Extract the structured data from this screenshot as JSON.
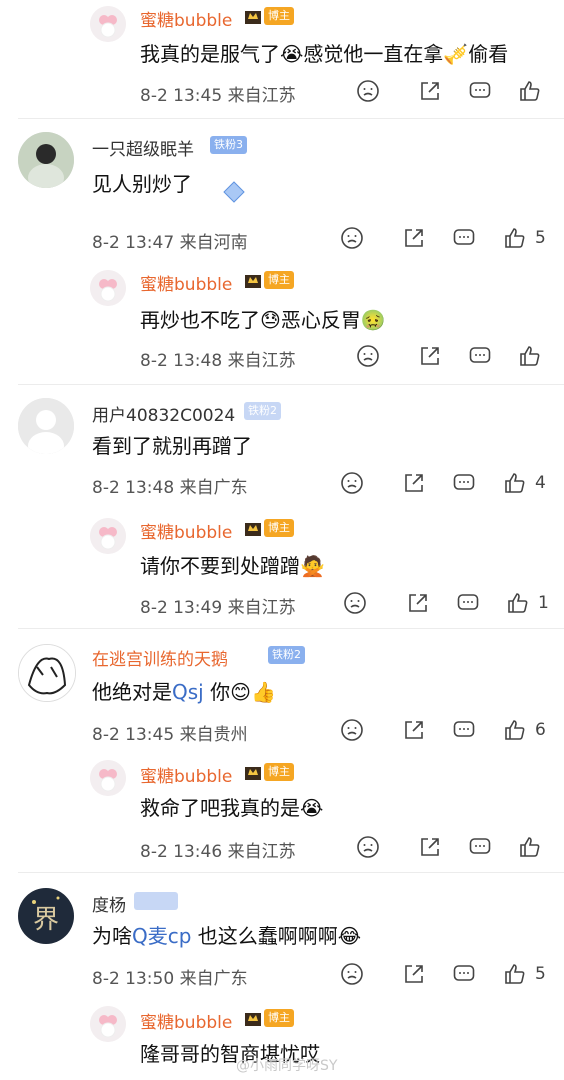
{
  "comments": [
    {
      "type": "reply",
      "name": "蜜糖bubble",
      "badge": "博主",
      "text_a": "我真的是服气了",
      "emoji_a": "😭",
      "text_b": "感觉他一直在拿",
      "emoji_b": "🎺",
      "text_c": "偷看",
      "time": "8-2 13:45",
      "loc": "来自江苏",
      "likes": ""
    },
    {
      "type": "main",
      "name": "一只超级眠羊",
      "badge": "铁粉3",
      "text_a": "见人别炒了",
      "time": "8-2 13:47",
      "loc": "来自河南",
      "likes": "5"
    },
    {
      "type": "reply",
      "name": "蜜糖bubble",
      "badge": "博主",
      "text_a": "再炒也不吃了",
      "emoji_a": "😓",
      "text_b": "恶心反胃",
      "emoji_b": "🤢",
      "time": "8-2 13:48",
      "loc": "来自江苏",
      "likes": ""
    },
    {
      "type": "main",
      "name": "用户40832C0024",
      "badge": "铁粉2",
      "text_a": "看到了就别再蹭了",
      "time": "8-2 13:48",
      "loc": "来自广东",
      "likes": "4"
    },
    {
      "type": "reply",
      "name": "蜜糖bubble",
      "badge": "博主",
      "text_a": "请你不要到处蹭蹭",
      "emoji_a": "🙅",
      "time": "8-2 13:49",
      "loc": "来自江苏",
      "likes": "1"
    },
    {
      "type": "main",
      "name": "在逃宫训练的天鹅",
      "badge": "铁粉2",
      "text_a": "他绝对是",
      "topic": "Qsj",
      "text_b": "你",
      "emoji_a": "😊",
      "emoji_b": "👍",
      "time": "8-2 13:45",
      "loc": "来自贵州",
      "likes": "6"
    },
    {
      "type": "reply",
      "name": "蜜糖bubble",
      "badge": "博主",
      "text_a": "救命了吧我真的是",
      "emoji_a": "😭",
      "time": "8-2 13:46",
      "loc": "来自江苏",
      "likes": ""
    },
    {
      "type": "main",
      "name": "度杨",
      "badge": "",
      "text_a": "为啥",
      "topic": "Q麦cp",
      "text_b": "也这么蠢啊啊啊",
      "emoji_a": "😂",
      "time": "8-2 13:50",
      "loc": "来自广东",
      "likes": "5"
    },
    {
      "type": "reply",
      "name": "蜜糖bubble",
      "badge": "博主",
      "text_a": "隆哥哥的智商堪忧哎",
      "time": "",
      "loc": "",
      "likes": ""
    }
  ],
  "watermark": "@小雨同学呀SY",
  "icons": {
    "dislike": "frown-icon",
    "share": "share-icon",
    "comment": "comment-icon",
    "like": "thumb-up-icon"
  },
  "colors": {
    "blogger": "#e8672f",
    "owner_badge": "#f5a623",
    "fan_badge": "#c7d7f5",
    "topic": "#3a6cc6"
  }
}
